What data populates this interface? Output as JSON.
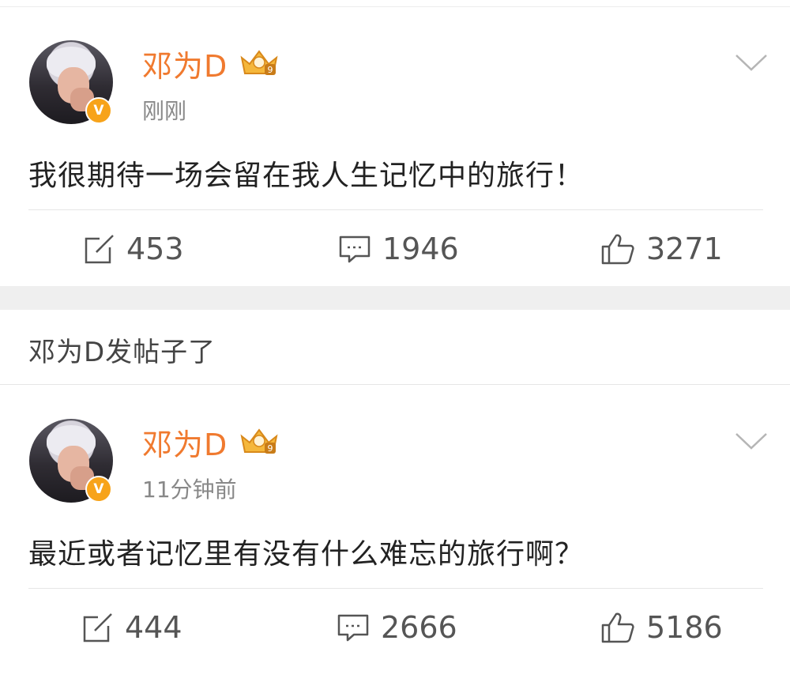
{
  "posts": [
    {
      "author": "邓为D",
      "level_badge": "9",
      "time": "刚刚",
      "content": "我很期待一场会留在我人生记忆中的旅行！",
      "actions": {
        "repost": "453",
        "comment": "1946",
        "like": "3271"
      }
    },
    {
      "author": "邓为D",
      "level_badge": "9",
      "time": "11分钟前",
      "content": "最近或者记忆里有没有什么难忘的旅行啊？",
      "actions": {
        "repost": "444",
        "comment": "2666",
        "like": "5186"
      }
    }
  ],
  "notice": "邓为D发帖子了",
  "verified_badge": "V",
  "colors": {
    "name": "#f07a2f",
    "badge": "#f7a31a",
    "gap": "#efefef"
  }
}
